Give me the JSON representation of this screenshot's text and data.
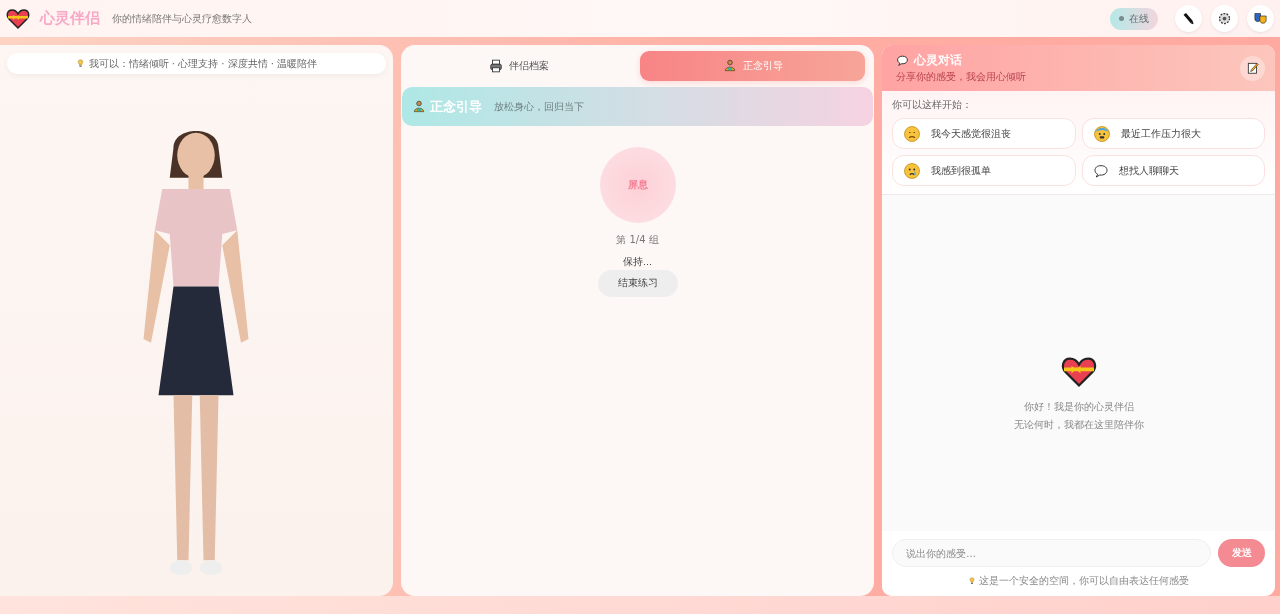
{
  "header": {
    "title": "心灵伴侣",
    "subtitle": "你的情绪陪伴与心灵疗愈数字人",
    "status": {
      "label": "在线",
      "online": true
    }
  },
  "avatar_panel": {
    "capabilities": "我可以：情绪倾听 · 心理支持 · 深度共情 · 温暖陪伴"
  },
  "tabs": [
    {
      "label": "伴侣档案",
      "selected": false,
      "kind": "profile"
    },
    {
      "label": "正念引导",
      "selected": true,
      "kind": "meditate"
    }
  ],
  "mindfulness": {
    "title": "正念引导",
    "subtitle": "放松身心，回归当下",
    "breath_phase": "屏息",
    "round": "第 1/4 组",
    "instruction": "保持...",
    "end_button": "结束练习"
  },
  "chat": {
    "title": "心灵对话",
    "subtitle": "分享你的感受，我会用心倾听",
    "prompt_label": "你可以这样开始：",
    "suggestions": [
      {
        "text": "我今天感觉很沮丧",
        "kind": "sad"
      },
      {
        "text": "最近工作压力很大",
        "kind": "anxious"
      },
      {
        "text": "我感到很孤单",
        "kind": "crying"
      },
      {
        "text": "想找人聊聊天",
        "kind": "chat"
      }
    ],
    "welcome_title": "你好！我是你的心灵伴侣",
    "welcome_subtitle": "无论何时，我都在这里陪伴你",
    "input_placeholder": "说出你的感受...",
    "send_button": "发送",
    "send_disabled": true,
    "footer_note": "这是一个安全的空间，你可以自由表达任何感受"
  }
}
